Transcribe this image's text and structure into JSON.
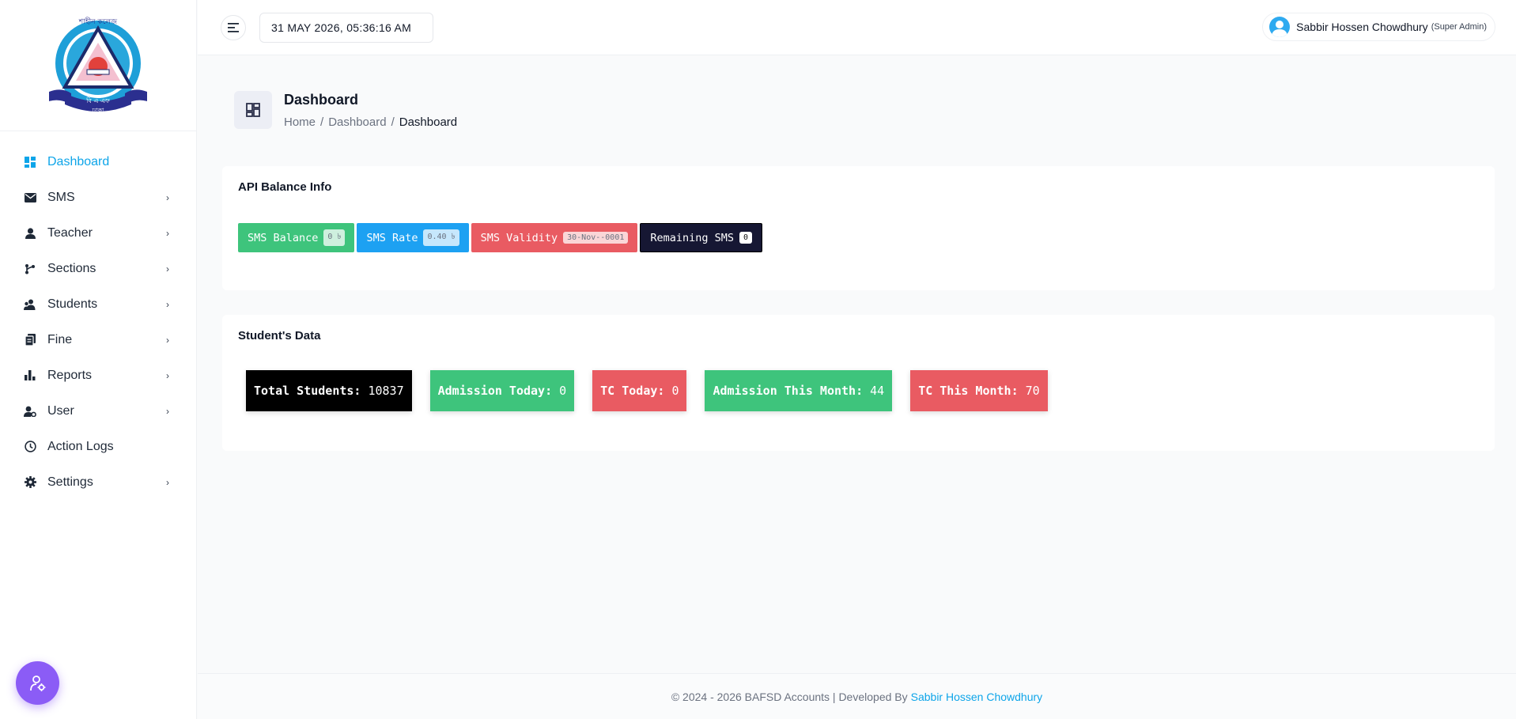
{
  "topbar": {
    "datetime": "31 MAY 2026, 05:36:16 AM",
    "user_name": "Sabbir Hossen Chowdhury",
    "user_role": "(Super Admin)"
  },
  "sidebar": {
    "items": [
      {
        "label": "Dashboard",
        "icon": "dashboard-icon",
        "active": true,
        "has_submenu": false
      },
      {
        "label": "SMS",
        "icon": "envelope-icon",
        "has_submenu": true
      },
      {
        "label": "Teacher",
        "icon": "user-icon",
        "has_submenu": true
      },
      {
        "label": "Sections",
        "icon": "branch-icon",
        "has_submenu": true
      },
      {
        "label": "Students",
        "icon": "users-icon",
        "has_submenu": true
      },
      {
        "label": "Fine",
        "icon": "documents-icon",
        "has_submenu": true
      },
      {
        "label": "Reports",
        "icon": "bar-chart-icon",
        "has_submenu": true
      },
      {
        "label": "User",
        "icon": "user-settings-icon",
        "has_submenu": true
      },
      {
        "label": "Action Logs",
        "icon": "clock-icon",
        "has_submenu": false
      },
      {
        "label": "Settings",
        "icon": "gear-icon",
        "has_submenu": true
      }
    ]
  },
  "page": {
    "title": "Dashboard",
    "breadcrumb": [
      "Home",
      "Dashboard",
      "Dashboard"
    ]
  },
  "api_balance": {
    "title": "API Balance Info",
    "badges": [
      {
        "label": "SMS Balance",
        "value": "0 ৳"
      },
      {
        "label": "SMS Rate",
        "value": "0.40 ৳"
      },
      {
        "label": "SMS Validity",
        "value": "30-Nov--0001"
      },
      {
        "label": "Remaining SMS",
        "value": "0"
      }
    ]
  },
  "student_data": {
    "title": "Student's Data",
    "stats": [
      {
        "label": "Total Students:",
        "value": "10837"
      },
      {
        "label": "Admission Today:",
        "value": "0"
      },
      {
        "label": "TC Today:",
        "value": "0"
      },
      {
        "label": "Admission This Month:",
        "value": "44"
      },
      {
        "label": "TC This Month:",
        "value": "70"
      }
    ]
  },
  "footer": {
    "text": "© 2024 - 2026 BAFSD Accounts | Developed By",
    "developer": "Sabbir Hossen Chowdhury"
  },
  "logo": {
    "text_top": "শাহীন কলেজ",
    "text_bottom": "বি এ এফ",
    "text_city": "ঢাকা"
  },
  "colors": {
    "accent": "#0ea5e9",
    "green": "#3ec47c",
    "blue": "#1da1f2",
    "red": "#e95b62",
    "navy": "#161733",
    "float_button": "#8b5cf6"
  }
}
